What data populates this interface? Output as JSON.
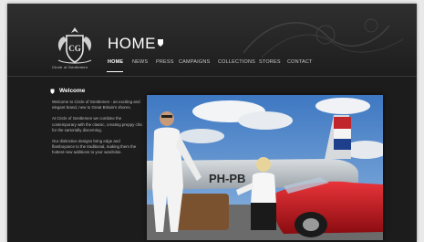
{
  "site": {
    "title": "HOME",
    "logo_text": "Circle of Gentlemen"
  },
  "nav": {
    "items": [
      {
        "label": "HOME",
        "active": true
      },
      {
        "label": "NEWS",
        "active": false
      },
      {
        "label": "PRESS",
        "active": false
      },
      {
        "label": "CAMPAIGNS",
        "active": false
      },
      {
        "label": "COLLECTIONS",
        "active": false
      },
      {
        "label": "STORES",
        "active": false
      },
      {
        "label": "CONTACT",
        "active": false
      }
    ]
  },
  "sidebar": {
    "heading": "Welcome",
    "paragraphs": [
      "Welcome to Circle of Gentlemen - an exciting and elegant brand, new to Great Britain's shores.",
      "At Circle of Gentlemen we combine the contemporary with the classic, creating preppy chic for the sartorially discerning.",
      "Our distinctive designs bring edge and flamboyance to the traditional, making them the hottest new additions to your wardrobe."
    ]
  },
  "hero": {
    "plane_registration": "PH-PB"
  },
  "colors": {
    "background": "#1c1c1c",
    "accent": "#ffffff",
    "car_red": "#c8161d"
  },
  "icons": {
    "title_marker": "shield-icon",
    "sidebar_marker": "shield-icon",
    "logo": "crest-logo"
  }
}
